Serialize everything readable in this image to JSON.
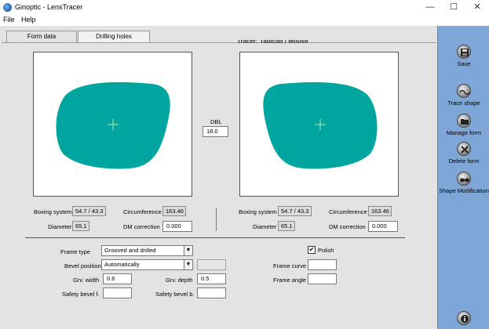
{
  "window": {
    "title": "Ginoptic - LensTracer",
    "minimize": "—",
    "maximize": "☐",
    "close": "✕"
  },
  "menu": [
    "File",
    "Help"
  ],
  "tabs": [
    {
      "label": "Form data",
      "active": true
    },
    {
      "label": "Drilling holes",
      "active": false
    }
  ],
  "tracer_label": "Tracer: Tablcad / Mouse",
  "shape_color": "#00a5a0",
  "dbl": {
    "label": "DBL",
    "value": "18.0"
  },
  "left_lens": {
    "boxing_label": "Boxing system",
    "boxing_value": "54.7 / 43.3",
    "circ_label": "Circumference",
    "circ_value": "163.46",
    "diam_label": "Diameter",
    "diam_value": "65.1",
    "dm_label": "DM correction",
    "dm_value": "0.000"
  },
  "right_lens": {
    "boxing_label": "Boxing system",
    "boxing_value": "54.7 / 43.3",
    "circ_label": "Circumference",
    "circ_value": "163.46",
    "diam_label": "Diameter",
    "diam_value": "65.1",
    "dm_label": "DM correction",
    "dm_value": "0.000"
  },
  "form": {
    "frame_type_label": "Frame type",
    "frame_type_value": "Grooved and drilled",
    "bevel_position_label": "Bevel position",
    "bevel_position_value": "Automatically",
    "grv_width_label": "Grv. width",
    "grv_width_value": "0.6",
    "grv_depth_label": "Grv. depth",
    "grv_depth_value": "0.5",
    "safety_bevel_f_label": "Safety bevel f.",
    "safety_bevel_f_value": "",
    "safety_bevel_b_label": "Safety bevel b.",
    "safety_bevel_b_value": "",
    "polish_label": "Polish",
    "polish_checked": true,
    "polish_mark": "✔",
    "frame_curve_label": "Frame curve",
    "frame_curve_value": "",
    "frame_angle_label": "Frame angle",
    "frame_angle_value": "",
    "dropdown_arrow": "▼"
  },
  "sidebar": [
    {
      "label": "Save",
      "icon": "save-icon"
    },
    {
      "label": "Trace shape",
      "icon": "trace-icon"
    },
    {
      "label": "Manage form",
      "icon": "folder-icon"
    },
    {
      "label": "Delete form",
      "icon": "delete-icon"
    },
    {
      "label": "Shape Modification",
      "icon": "glasses-icon"
    },
    {
      "label": "",
      "icon": "info-icon"
    }
  ]
}
